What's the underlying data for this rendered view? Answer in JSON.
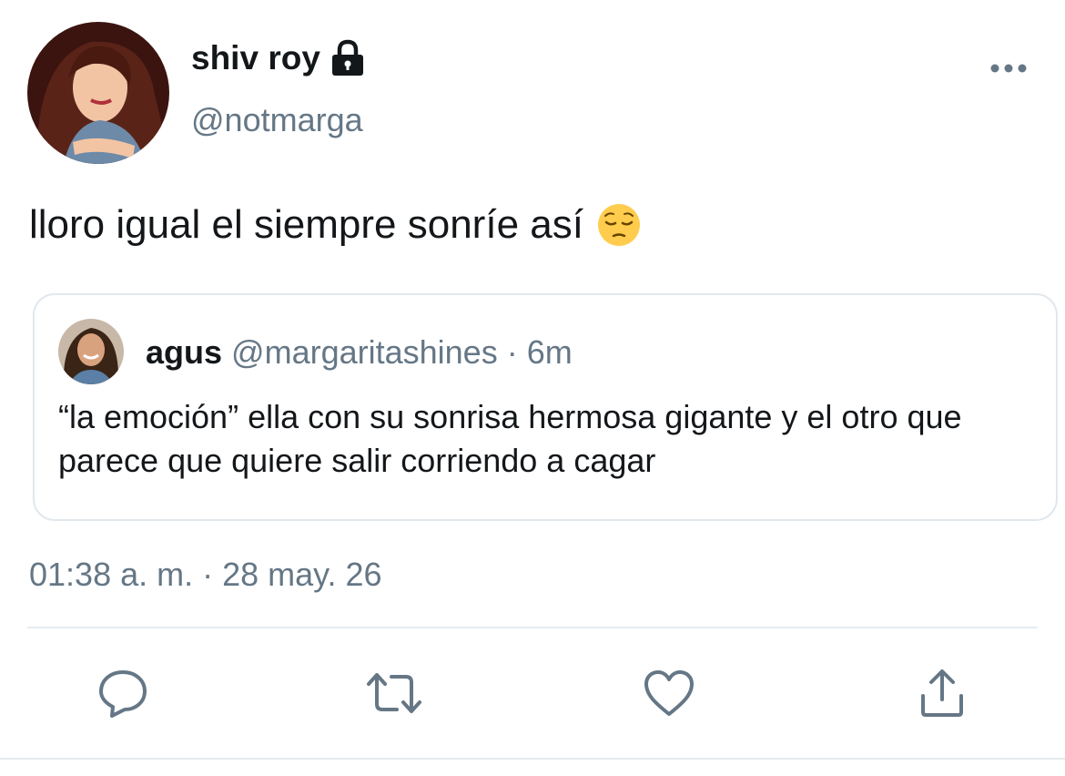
{
  "author": {
    "display_name": "shiv roy",
    "handle": "@notmarga",
    "avatar_icon": "avatar-illustration",
    "protected_icon": "lock-icon"
  },
  "tweet": {
    "text": "lloro igual el siempre sonríe así",
    "emoji": "pensive-face-emoji",
    "timestamp": "01:38 a. m. · 28 may. 26"
  },
  "quote": {
    "name": "agus",
    "handle": "@margaritashines",
    "separator": "·",
    "time": "6m",
    "text": "“la emoción” ella con su sonrisa hermosa gigante y el otro que parece que quiere salir corriendo a cagar"
  },
  "actions": [
    "reply-icon",
    "retweet-icon",
    "like-icon",
    "share-icon"
  ],
  "colors": {
    "text": "#14171a",
    "secondary": "#657786",
    "border": "#e1e8ed",
    "icon": "#657786"
  }
}
